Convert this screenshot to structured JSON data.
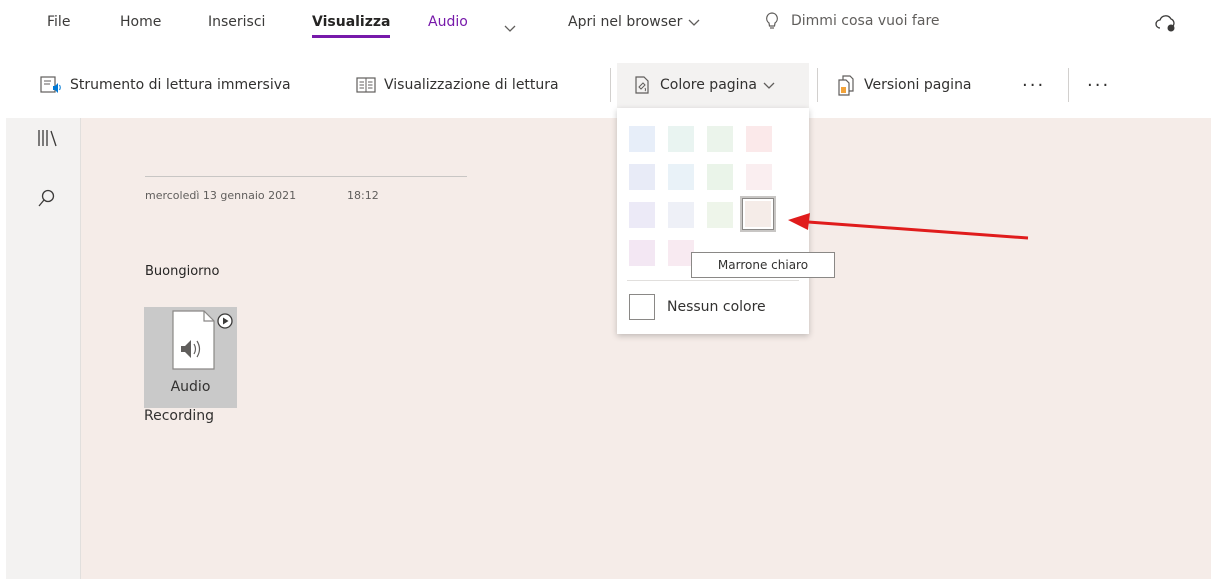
{
  "menu": {
    "file": "File",
    "home": "Home",
    "inserisci": "Inserisci",
    "visualizza": "Visualizza",
    "audio": "Audio",
    "apri_browser": "Apri nel browser",
    "search_placeholder": "Dimmi cosa vuoi fare"
  },
  "toolbar": {
    "immersive_reader": "Strumento di lettura immersiva",
    "reading_view": "Visualizzazione di lettura",
    "page_color": "Colore pagina",
    "page_versions": "Versioni pagina",
    "more1": "···",
    "more2": "···"
  },
  "page": {
    "date": "mercoledì 13 gennaio 2021",
    "time": "18:12",
    "body_text": "Buongiorno",
    "audio_label_1": "Audio",
    "audio_label_2": "Recording",
    "background_color": "#f5ece8"
  },
  "color_menu": {
    "tooltip": "Marrone chiaro",
    "no_color": "Nessun colore",
    "swatches": [
      [
        "#e7eef9",
        "#e9f4f1",
        "#ebf4eb",
        "#fbe9ea"
      ],
      [
        "#e8ebf7",
        "#e9f2f8",
        "#eaf4e9",
        "#faeef0"
      ],
      [
        "#eceaf7",
        "#eef0f7",
        "#eef5ea",
        "#f5ece8"
      ],
      [
        "#f3e7f3",
        "#f8eaf1",
        "#ffffff",
        "#ffffff"
      ]
    ]
  }
}
